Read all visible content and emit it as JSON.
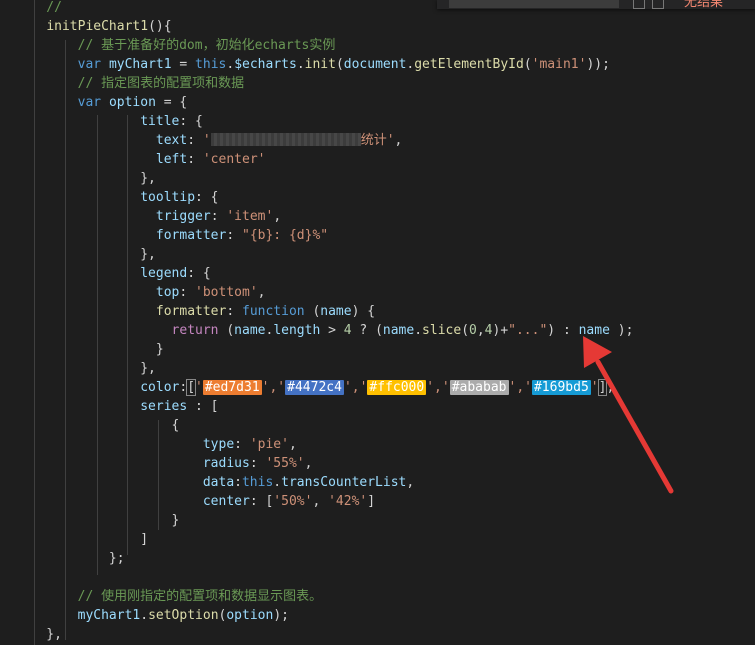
{
  "editor": {
    "find_widget": {
      "result_text": "无结果"
    },
    "accent_colors": {
      "arrow": "#e53935",
      "swatch_1": "#ed7d31",
      "swatch_2": "#4472c4",
      "swatch_3": "#ffc000",
      "swatch_4": "#ababab",
      "swatch_5": "#169bd5"
    },
    "code_lines": [
      [
        {
          "t": "    //",
          "c": "comment"
        }
      ],
      [
        {
          "t": "    ",
          "c": "plain"
        },
        {
          "t": "initPieChart1",
          "c": "fn"
        },
        {
          "t": "(){",
          "c": "plain"
        }
      ],
      [
        {
          "t": "        // 基于准备好的dom，初始化echarts实例",
          "c": "comment"
        }
      ],
      [
        {
          "t": "        ",
          "c": "plain"
        },
        {
          "t": "var",
          "c": "kw"
        },
        {
          "t": " ",
          "c": "plain"
        },
        {
          "t": "myChart1",
          "c": "var"
        },
        {
          "t": " = ",
          "c": "plain"
        },
        {
          "t": "this",
          "c": "kw"
        },
        {
          "t": ".",
          "c": "plain"
        },
        {
          "t": "$echarts",
          "c": "var"
        },
        {
          "t": ".",
          "c": "plain"
        },
        {
          "t": "init",
          "c": "fn"
        },
        {
          "t": "(",
          "c": "plain"
        },
        {
          "t": "document",
          "c": "var"
        },
        {
          "t": ".",
          "c": "plain"
        },
        {
          "t": "getElementById",
          "c": "fn"
        },
        {
          "t": "(",
          "c": "plain"
        },
        {
          "t": "'main1'",
          "c": "str"
        },
        {
          "t": "));",
          "c": "plain"
        }
      ],
      [
        {
          "t": "        // 指定图表的配置项和数据",
          "c": "comment"
        }
      ],
      [
        {
          "t": "        ",
          "c": "plain"
        },
        {
          "t": "var",
          "c": "kw"
        },
        {
          "t": " ",
          "c": "plain"
        },
        {
          "t": "option",
          "c": "var"
        },
        {
          "t": " = {",
          "c": "plain"
        }
      ],
      [
        {
          "t": "                ",
          "c": "plain"
        },
        {
          "t": "title",
          "c": "var"
        },
        {
          "t": ": {",
          "c": "plain"
        }
      ],
      [
        {
          "t": "                  ",
          "c": "plain"
        },
        {
          "t": "text",
          "c": "var"
        },
        {
          "t": ": ",
          "c": "plain"
        },
        {
          "t": "'",
          "c": "str"
        },
        {
          "t": "",
          "c": "redact",
          "w": 150
        },
        {
          "t": "统计'",
          "c": "str"
        },
        {
          "t": ",",
          "c": "plain"
        }
      ],
      [
        {
          "t": "                  ",
          "c": "plain"
        },
        {
          "t": "left",
          "c": "var"
        },
        {
          "t": ": ",
          "c": "plain"
        },
        {
          "t": "'center'",
          "c": "str"
        }
      ],
      [
        {
          "t": "                },",
          "c": "plain"
        }
      ],
      [
        {
          "t": "                ",
          "c": "plain"
        },
        {
          "t": "tooltip",
          "c": "var"
        },
        {
          "t": ": {",
          "c": "plain"
        }
      ],
      [
        {
          "t": "                  ",
          "c": "plain"
        },
        {
          "t": "trigger",
          "c": "var"
        },
        {
          "t": ": ",
          "c": "plain"
        },
        {
          "t": "'item'",
          "c": "str"
        },
        {
          "t": ",",
          "c": "plain"
        }
      ],
      [
        {
          "t": "                  ",
          "c": "plain"
        },
        {
          "t": "formatter",
          "c": "var"
        },
        {
          "t": ": ",
          "c": "plain"
        },
        {
          "t": "\"{b}: {d}%\"",
          "c": "str"
        }
      ],
      [
        {
          "t": "                },",
          "c": "plain"
        }
      ],
      [
        {
          "t": "                ",
          "c": "plain"
        },
        {
          "t": "legend",
          "c": "var"
        },
        {
          "t": ": {",
          "c": "plain"
        }
      ],
      [
        {
          "t": "                  ",
          "c": "plain"
        },
        {
          "t": "top",
          "c": "var"
        },
        {
          "t": ": ",
          "c": "plain"
        },
        {
          "t": "'bottom'",
          "c": "str"
        },
        {
          "t": ",",
          "c": "plain"
        }
      ],
      [
        {
          "t": "                  ",
          "c": "plain"
        },
        {
          "t": "formatter",
          "c": "fn"
        },
        {
          "t": ": ",
          "c": "plain"
        },
        {
          "t": "function",
          "c": "kw"
        },
        {
          "t": " (",
          "c": "plain"
        },
        {
          "t": "name",
          "c": "var"
        },
        {
          "t": ") {",
          "c": "plain"
        }
      ],
      [
        {
          "t": "                    ",
          "c": "plain"
        },
        {
          "t": "return",
          "c": "ctrl"
        },
        {
          "t": " (",
          "c": "plain"
        },
        {
          "t": "name",
          "c": "var"
        },
        {
          "t": ".",
          "c": "plain"
        },
        {
          "t": "length",
          "c": "var"
        },
        {
          "t": " > ",
          "c": "plain"
        },
        {
          "t": "4",
          "c": "num"
        },
        {
          "t": " ? (",
          "c": "plain"
        },
        {
          "t": "name",
          "c": "var"
        },
        {
          "t": ".",
          "c": "plain"
        },
        {
          "t": "slice",
          "c": "fn"
        },
        {
          "t": "(",
          "c": "plain"
        },
        {
          "t": "0",
          "c": "num"
        },
        {
          "t": ",",
          "c": "plain"
        },
        {
          "t": "4",
          "c": "num"
        },
        {
          "t": ")+",
          "c": "plain"
        },
        {
          "t": "\"...\"",
          "c": "str"
        },
        {
          "t": ") : ",
          "c": "plain"
        },
        {
          "t": "name",
          "c": "var"
        },
        {
          "t": " );",
          "c": "plain"
        }
      ],
      [
        {
          "t": "                  }",
          "c": "plain"
        }
      ],
      [
        {
          "t": "                },",
          "c": "plain"
        }
      ],
      [
        {
          "t": "                ",
          "c": "plain"
        },
        {
          "t": "color",
          "c": "var"
        },
        {
          "t": ":",
          "c": "plain"
        },
        {
          "t": "[",
          "c": "bracket"
        },
        {
          "t": "'",
          "c": "str"
        },
        {
          "t": "#ed7d31",
          "c": "swatch",
          "bg": "#ed7d31"
        },
        {
          "t": "','",
          "c": "str"
        },
        {
          "t": "#4472c4",
          "c": "swatch",
          "bg": "#4472c4"
        },
        {
          "t": "','",
          "c": "str"
        },
        {
          "t": "#ffc000",
          "c": "swatch",
          "bg": "#ffc000"
        },
        {
          "t": "','",
          "c": "str"
        },
        {
          "t": "#ababab",
          "c": "swatch",
          "bg": "#ababab"
        },
        {
          "t": "','",
          "c": "str"
        },
        {
          "t": "#169bd5",
          "c": "swatch",
          "bg": "#169bd5"
        },
        {
          "t": "'",
          "c": "str"
        },
        {
          "t": "]",
          "c": "bracket"
        },
        {
          "t": ",",
          "c": "plain"
        }
      ],
      [
        {
          "t": "                ",
          "c": "plain"
        },
        {
          "t": "series",
          "c": "var"
        },
        {
          "t": " : [",
          "c": "plain"
        }
      ],
      [
        {
          "t": "                    {",
          "c": "plain"
        }
      ],
      [
        {
          "t": "                        ",
          "c": "plain"
        },
        {
          "t": "type",
          "c": "var"
        },
        {
          "t": ": ",
          "c": "plain"
        },
        {
          "t": "'pie'",
          "c": "str"
        },
        {
          "t": ",",
          "c": "plain"
        }
      ],
      [
        {
          "t": "                        ",
          "c": "plain"
        },
        {
          "t": "radius",
          "c": "var"
        },
        {
          "t": ": ",
          "c": "plain"
        },
        {
          "t": "'55%'",
          "c": "str"
        },
        {
          "t": ",",
          "c": "plain"
        }
      ],
      [
        {
          "t": "                        ",
          "c": "plain"
        },
        {
          "t": "data",
          "c": "var"
        },
        {
          "t": ":",
          "c": "plain"
        },
        {
          "t": "this",
          "c": "kw"
        },
        {
          "t": ".",
          "c": "plain"
        },
        {
          "t": "transCounterList",
          "c": "var"
        },
        {
          "t": ",",
          "c": "plain"
        }
      ],
      [
        {
          "t": "                        ",
          "c": "plain"
        },
        {
          "t": "center",
          "c": "var"
        },
        {
          "t": ": [",
          "c": "plain"
        },
        {
          "t": "'50%'",
          "c": "str"
        },
        {
          "t": ", ",
          "c": "plain"
        },
        {
          "t": "'42%'",
          "c": "str"
        },
        {
          "t": "]",
          "c": "plain"
        }
      ],
      [
        {
          "t": "                    }",
          "c": "plain"
        }
      ],
      [
        {
          "t": "                ]",
          "c": "plain"
        }
      ],
      [
        {
          "t": "            };",
          "c": "plain"
        }
      ],
      [
        {
          "t": "",
          "c": "plain"
        }
      ],
      [
        {
          "t": "        // 使用刚指定的配置项和数据显示图表。",
          "c": "comment"
        }
      ],
      [
        {
          "t": "        ",
          "c": "plain"
        },
        {
          "t": "myChart1",
          "c": "var"
        },
        {
          "t": ".",
          "c": "plain"
        },
        {
          "t": "setOption",
          "c": "fn"
        },
        {
          "t": "(",
          "c": "plain"
        },
        {
          "t": "option",
          "c": "var"
        },
        {
          "t": ");",
          "c": "plain"
        }
      ],
      [
        {
          "t": "    },",
          "c": "plain"
        }
      ]
    ]
  }
}
